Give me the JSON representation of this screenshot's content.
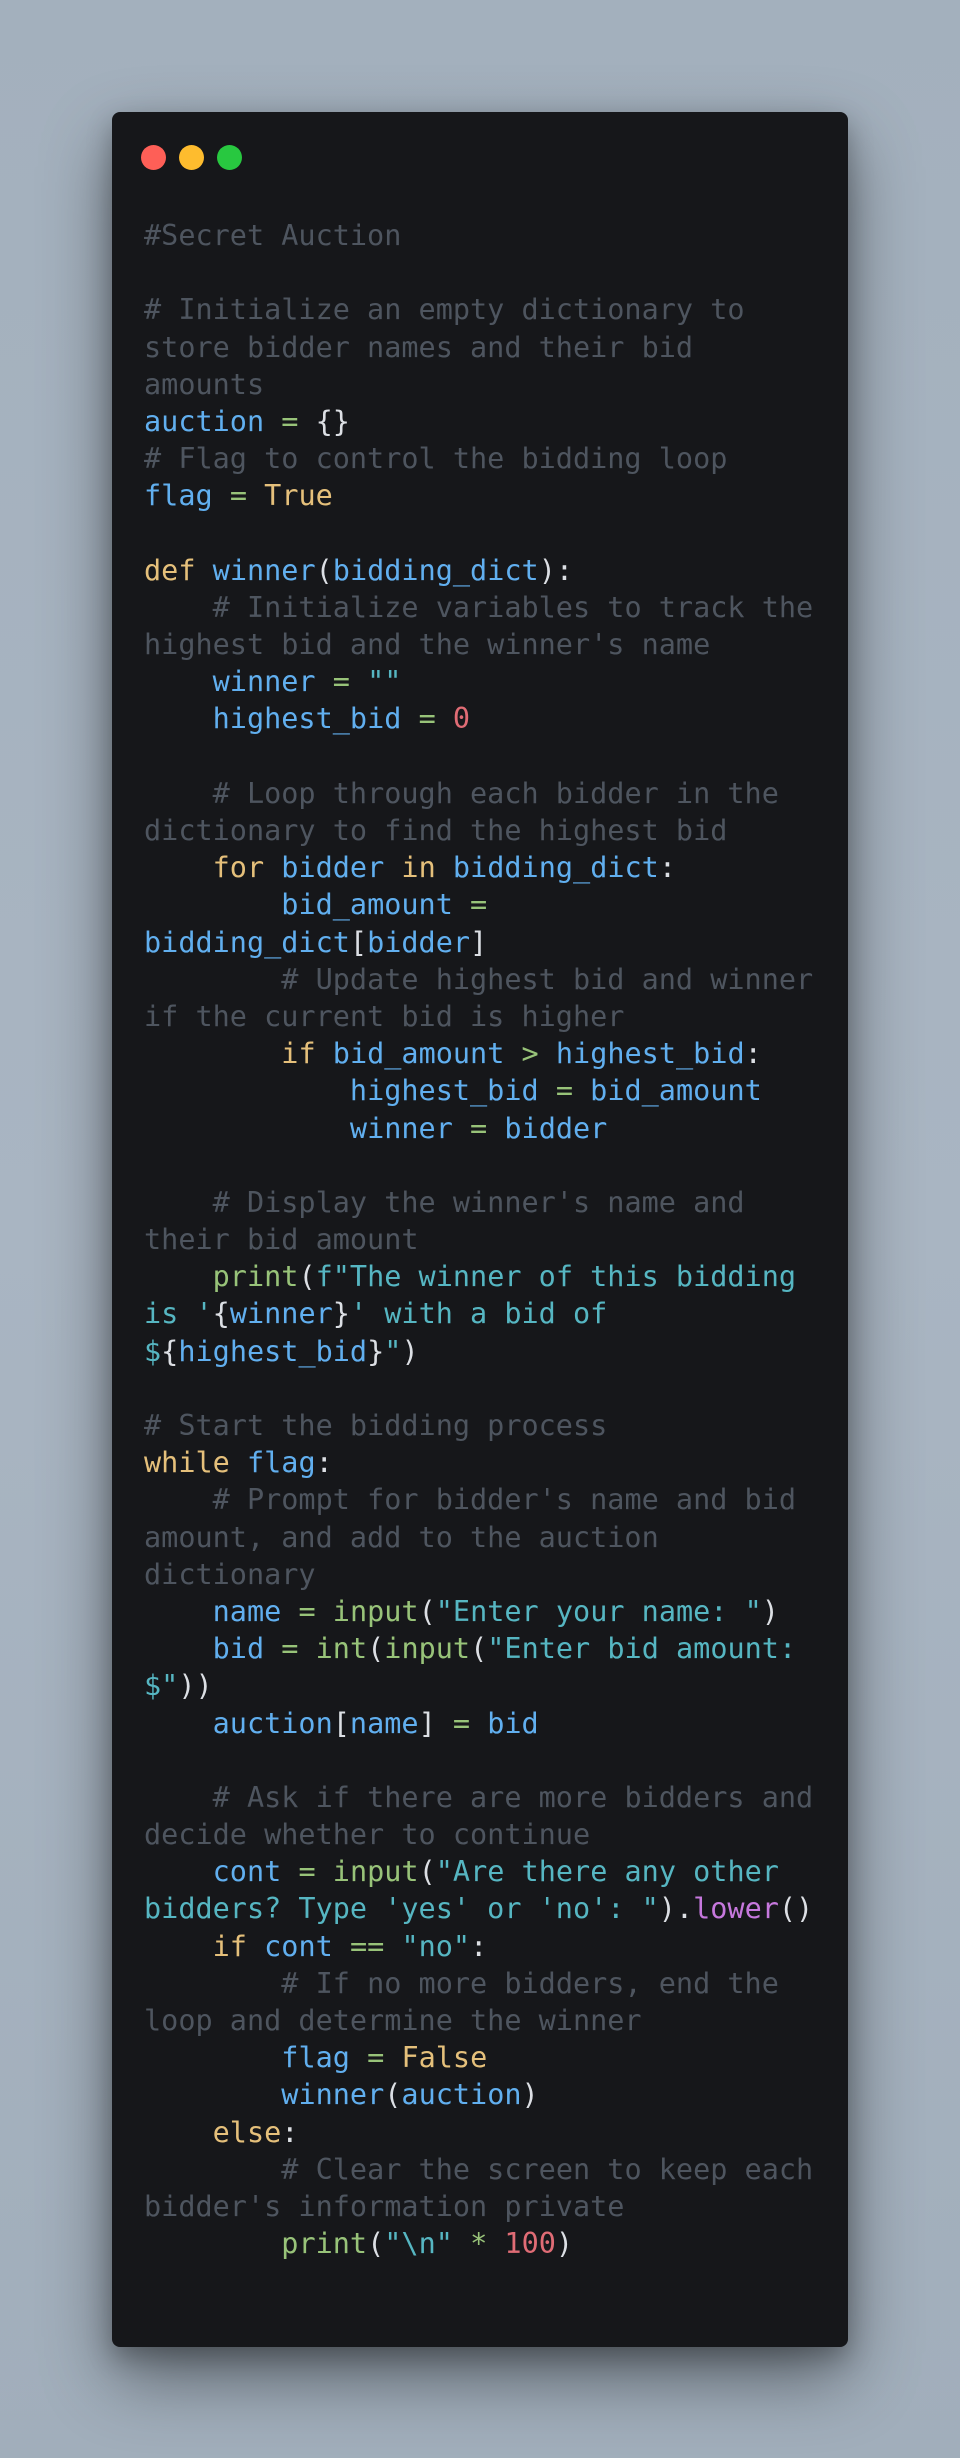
{
  "window": {
    "controls": [
      {
        "name": "close",
        "color": "#fe5f57"
      },
      {
        "name": "minimize",
        "color": "#febc2e"
      },
      {
        "name": "maximize",
        "color": "#28c840"
      }
    ]
  },
  "theme": {
    "background": "#16171a",
    "comment": "#4e555f",
    "identifier": "#61afef",
    "keyword": "#e5c07b",
    "function": "#98c379",
    "string": "#56b6c2",
    "number": "#e06c75",
    "method": "#c678dd",
    "punctuation": "#dcdfe4"
  },
  "code_lines": [
    [
      {
        "t": "c",
        "text": "#Secret Auction"
      }
    ],
    [],
    [
      {
        "t": "c",
        "text": "# Initialize an empty dictionary to"
      }
    ],
    [
      {
        "t": "c",
        "text": "store bidder names and their bid"
      }
    ],
    [
      {
        "t": "c",
        "text": "amounts"
      }
    ],
    [
      {
        "t": "v",
        "text": "auction"
      },
      {
        "t": "p",
        "text": " "
      },
      {
        "t": "f",
        "text": "="
      },
      {
        "t": "p",
        "text": " {}"
      }
    ],
    [
      {
        "t": "c",
        "text": "# Flag to control the bidding loop"
      }
    ],
    [
      {
        "t": "v",
        "text": "flag"
      },
      {
        "t": "p",
        "text": " "
      },
      {
        "t": "f",
        "text": "="
      },
      {
        "t": "p",
        "text": " "
      },
      {
        "t": "k",
        "text": "True"
      }
    ],
    [],
    [
      {
        "t": "k",
        "text": "def"
      },
      {
        "t": "p",
        "text": " "
      },
      {
        "t": "v",
        "text": "winner"
      },
      {
        "t": "p",
        "text": "("
      },
      {
        "t": "v",
        "text": "bidding_dict"
      },
      {
        "t": "p",
        "text": "):"
      }
    ],
    [
      {
        "t": "p",
        "text": "    "
      },
      {
        "t": "c",
        "text": "# Initialize variables to track the"
      }
    ],
    [
      {
        "t": "c",
        "text": "highest bid and the winner's name"
      }
    ],
    [
      {
        "t": "p",
        "text": "    "
      },
      {
        "t": "v",
        "text": "winner"
      },
      {
        "t": "p",
        "text": " "
      },
      {
        "t": "f",
        "text": "="
      },
      {
        "t": "p",
        "text": " "
      },
      {
        "t": "s",
        "text": "\"\""
      }
    ],
    [
      {
        "t": "p",
        "text": "    "
      },
      {
        "t": "v",
        "text": "highest_bid"
      },
      {
        "t": "p",
        "text": " "
      },
      {
        "t": "f",
        "text": "="
      },
      {
        "t": "p",
        "text": " "
      },
      {
        "t": "n",
        "text": "0"
      }
    ],
    [],
    [
      {
        "t": "p",
        "text": "    "
      },
      {
        "t": "c",
        "text": "# Loop through each bidder in the"
      }
    ],
    [
      {
        "t": "c",
        "text": "dictionary to find the highest bid"
      }
    ],
    [
      {
        "t": "p",
        "text": "    "
      },
      {
        "t": "k",
        "text": "for"
      },
      {
        "t": "p",
        "text": " "
      },
      {
        "t": "v",
        "text": "bidder"
      },
      {
        "t": "p",
        "text": " "
      },
      {
        "t": "k",
        "text": "in"
      },
      {
        "t": "p",
        "text": " "
      },
      {
        "t": "v",
        "text": "bidding_dict"
      },
      {
        "t": "p",
        "text": ":"
      }
    ],
    [
      {
        "t": "p",
        "text": "        "
      },
      {
        "t": "v",
        "text": "bid_amount"
      },
      {
        "t": "p",
        "text": " "
      },
      {
        "t": "f",
        "text": "="
      }
    ],
    [
      {
        "t": "v",
        "text": "bidding_dict"
      },
      {
        "t": "p",
        "text": "["
      },
      {
        "t": "v",
        "text": "bidder"
      },
      {
        "t": "p",
        "text": "]"
      }
    ],
    [
      {
        "t": "p",
        "text": "        "
      },
      {
        "t": "c",
        "text": "# Update highest bid and winner"
      }
    ],
    [
      {
        "t": "c",
        "text": "if the current bid is higher"
      }
    ],
    [
      {
        "t": "p",
        "text": "        "
      },
      {
        "t": "k",
        "text": "if"
      },
      {
        "t": "p",
        "text": " "
      },
      {
        "t": "v",
        "text": "bid_amount"
      },
      {
        "t": "p",
        "text": " "
      },
      {
        "t": "f",
        "text": ">"
      },
      {
        "t": "p",
        "text": " "
      },
      {
        "t": "v",
        "text": "highest_bid"
      },
      {
        "t": "p",
        "text": ":"
      }
    ],
    [
      {
        "t": "p",
        "text": "            "
      },
      {
        "t": "v",
        "text": "highest_bid"
      },
      {
        "t": "p",
        "text": " "
      },
      {
        "t": "f",
        "text": "="
      },
      {
        "t": "p",
        "text": " "
      },
      {
        "t": "v",
        "text": "bid_amount"
      }
    ],
    [
      {
        "t": "p",
        "text": "            "
      },
      {
        "t": "v",
        "text": "winner"
      },
      {
        "t": "p",
        "text": " "
      },
      {
        "t": "f",
        "text": "="
      },
      {
        "t": "p",
        "text": " "
      },
      {
        "t": "v",
        "text": "bidder"
      }
    ],
    [],
    [
      {
        "t": "p",
        "text": "    "
      },
      {
        "t": "c",
        "text": "# Display the winner's name and"
      }
    ],
    [
      {
        "t": "c",
        "text": "their bid amount"
      }
    ],
    [
      {
        "t": "p",
        "text": "    "
      },
      {
        "t": "f",
        "text": "print"
      },
      {
        "t": "p",
        "text": "("
      },
      {
        "t": "s",
        "text": "f\"The winner of this bidding"
      }
    ],
    [
      {
        "t": "s",
        "text": "is '"
      },
      {
        "t": "p",
        "text": "{"
      },
      {
        "t": "v",
        "text": "winner"
      },
      {
        "t": "p",
        "text": "}"
      },
      {
        "t": "s",
        "text": "' with a bid of"
      }
    ],
    [
      {
        "t": "s",
        "text": "$"
      },
      {
        "t": "p",
        "text": "{"
      },
      {
        "t": "v",
        "text": "highest_bid"
      },
      {
        "t": "p",
        "text": "}"
      },
      {
        "t": "s",
        "text": "\""
      },
      {
        "t": "p",
        "text": ")"
      }
    ],
    [],
    [
      {
        "t": "c",
        "text": "# Start the bidding process"
      }
    ],
    [
      {
        "t": "k",
        "text": "while"
      },
      {
        "t": "p",
        "text": " "
      },
      {
        "t": "v",
        "text": "flag"
      },
      {
        "t": "p",
        "text": ":"
      }
    ],
    [
      {
        "t": "p",
        "text": "    "
      },
      {
        "t": "c",
        "text": "# Prompt for bidder's name and bid"
      }
    ],
    [
      {
        "t": "c",
        "text": "amount, and add to the auction"
      }
    ],
    [
      {
        "t": "c",
        "text": "dictionary"
      }
    ],
    [
      {
        "t": "p",
        "text": "    "
      },
      {
        "t": "v",
        "text": "name"
      },
      {
        "t": "p",
        "text": " "
      },
      {
        "t": "f",
        "text": "="
      },
      {
        "t": "p",
        "text": " "
      },
      {
        "t": "f",
        "text": "input"
      },
      {
        "t": "p",
        "text": "("
      },
      {
        "t": "s",
        "text": "\"Enter your name: \""
      },
      {
        "t": "p",
        "text": ")"
      }
    ],
    [
      {
        "t": "p",
        "text": "    "
      },
      {
        "t": "v",
        "text": "bid"
      },
      {
        "t": "p",
        "text": " "
      },
      {
        "t": "f",
        "text": "="
      },
      {
        "t": "p",
        "text": " "
      },
      {
        "t": "f",
        "text": "int"
      },
      {
        "t": "p",
        "text": "("
      },
      {
        "t": "f",
        "text": "input"
      },
      {
        "t": "p",
        "text": "("
      },
      {
        "t": "s",
        "text": "\"Enter bid amount:"
      }
    ],
    [
      {
        "t": "s",
        "text": "$\""
      },
      {
        "t": "p",
        "text": "))"
      }
    ],
    [
      {
        "t": "p",
        "text": "    "
      },
      {
        "t": "v",
        "text": "auction"
      },
      {
        "t": "p",
        "text": "["
      },
      {
        "t": "v",
        "text": "name"
      },
      {
        "t": "p",
        "text": "] "
      },
      {
        "t": "f",
        "text": "="
      },
      {
        "t": "p",
        "text": " "
      },
      {
        "t": "v",
        "text": "bid"
      }
    ],
    [],
    [
      {
        "t": "p",
        "text": "    "
      },
      {
        "t": "c",
        "text": "# Ask if there are more bidders and"
      }
    ],
    [
      {
        "t": "c",
        "text": "decide whether to continue"
      }
    ],
    [
      {
        "t": "p",
        "text": "    "
      },
      {
        "t": "v",
        "text": "cont"
      },
      {
        "t": "p",
        "text": " "
      },
      {
        "t": "f",
        "text": "="
      },
      {
        "t": "p",
        "text": " "
      },
      {
        "t": "f",
        "text": "input"
      },
      {
        "t": "p",
        "text": "("
      },
      {
        "t": "s",
        "text": "\"Are there any other"
      }
    ],
    [
      {
        "t": "s",
        "text": "bidders? Type 'yes' or 'no': \""
      },
      {
        "t": "p",
        "text": ")."
      },
      {
        "t": "m",
        "text": "lower"
      },
      {
        "t": "p",
        "text": "()"
      }
    ],
    [
      {
        "t": "p",
        "text": "    "
      },
      {
        "t": "k",
        "text": "if"
      },
      {
        "t": "p",
        "text": " "
      },
      {
        "t": "v",
        "text": "cont"
      },
      {
        "t": "p",
        "text": " "
      },
      {
        "t": "f",
        "text": "=="
      },
      {
        "t": "p",
        "text": " "
      },
      {
        "t": "s",
        "text": "\"no\""
      },
      {
        "t": "p",
        "text": ":"
      }
    ],
    [
      {
        "t": "p",
        "text": "        "
      },
      {
        "t": "c",
        "text": "# If no more bidders, end the"
      }
    ],
    [
      {
        "t": "c",
        "text": "loop and determine the winner"
      }
    ],
    [
      {
        "t": "p",
        "text": "        "
      },
      {
        "t": "v",
        "text": "flag"
      },
      {
        "t": "p",
        "text": " "
      },
      {
        "t": "f",
        "text": "="
      },
      {
        "t": "p",
        "text": " "
      },
      {
        "t": "k",
        "text": "False"
      }
    ],
    [
      {
        "t": "p",
        "text": "        "
      },
      {
        "t": "v",
        "text": "winner"
      },
      {
        "t": "p",
        "text": "("
      },
      {
        "t": "v",
        "text": "auction"
      },
      {
        "t": "p",
        "text": ")"
      }
    ],
    [
      {
        "t": "p",
        "text": "    "
      },
      {
        "t": "k",
        "text": "else"
      },
      {
        "t": "p",
        "text": ":"
      }
    ],
    [
      {
        "t": "p",
        "text": "        "
      },
      {
        "t": "c",
        "text": "# Clear the screen to keep each"
      }
    ],
    [
      {
        "t": "c",
        "text": "bidder's information private"
      }
    ],
    [
      {
        "t": "p",
        "text": "        "
      },
      {
        "t": "f",
        "text": "print"
      },
      {
        "t": "p",
        "text": "("
      },
      {
        "t": "s",
        "text": "\"\\n\""
      },
      {
        "t": "p",
        "text": " "
      },
      {
        "t": "f",
        "text": "*"
      },
      {
        "t": "p",
        "text": " "
      },
      {
        "t": "n",
        "text": "100"
      },
      {
        "t": "p",
        "text": ")"
      }
    ]
  ]
}
